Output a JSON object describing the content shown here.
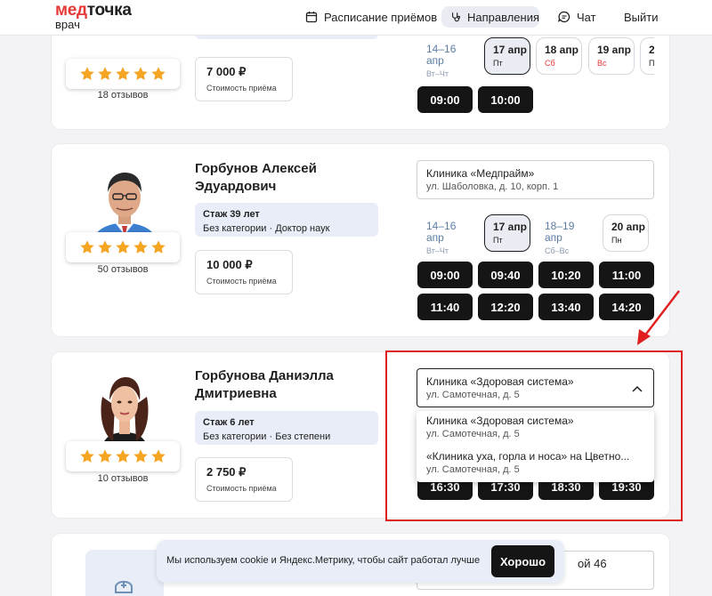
{
  "header": {
    "logo_top": "мед",
    "logo_top_2": "точка",
    "logo_sub": "врач",
    "nav": {
      "schedule": "Расписание приёмов",
      "directions": "Направления",
      "chat": "Чат",
      "logout": "Выйти"
    }
  },
  "cards": [
    {
      "reviews": "18 отзывов",
      "price": "7 000 ₽",
      "price_label": "Стоимость приёма",
      "dates": [
        {
          "d": "14–16 апр",
          "w": "Вт–Чт"
        },
        {
          "d": "17 апр",
          "w": "Пт"
        },
        {
          "d": "18 апр",
          "w": "Сб"
        },
        {
          "d": "19 апр",
          "w": "Вс"
        },
        {
          "d": "2",
          "w": "П"
        }
      ],
      "slots": [
        "09:00",
        "10:00"
      ]
    },
    {
      "name_line1": "Горбунов Алексей",
      "name_line2": "Эдуардович",
      "experience": "Стаж 39 лет",
      "category": "Без категории · Доктор наук",
      "reviews": "50 отзывов",
      "price": "10 000 ₽",
      "price_label": "Стоимость приёма",
      "clinic_name": "Клиника «Медпрайм»",
      "clinic_address": "ул. Шаболовка, д. 10, корп. 1",
      "dates": [
        {
          "d": "14–16 апр",
          "w": "Вт–Чт"
        },
        {
          "d": "17 апр",
          "w": "Пт"
        },
        {
          "d": "18–19 апр",
          "w": "Сб–Вс"
        },
        {
          "d": "20 апр",
          "w": "Пн"
        }
      ],
      "slots": [
        "09:00",
        "09:40",
        "10:20",
        "11:00",
        "11:40",
        "12:20",
        "13:40",
        "14:20"
      ]
    },
    {
      "name_line1": "Горбунова Даниэлла",
      "name_line2": "Дмитриевна",
      "experience": "Стаж 6 лет",
      "category": "Без категории · Без степени",
      "reviews": "10 отзывов",
      "price": "2 750 ₽",
      "price_label": "Стоимость приёма",
      "clinic_name": "Клиника «Здоровая система»",
      "clinic_address": "ул. Самотечная, д. 5",
      "dropdown_options": [
        {
          "name": "Клиника «Здоровая система»",
          "address": "ул. Самотечная, д. 5"
        },
        {
          "name": "«Клиника уха, горла и носа» на Цветно...",
          "address": "ул. Самотечная, д. 5"
        }
      ],
      "slots": [
        "16:30",
        "17:30",
        "18:30",
        "19:30"
      ]
    },
    {
      "clinic_partial": "ой 46"
    }
  ],
  "cookie": {
    "text": "Мы используем cookie и Яндекс.Метрику, чтобы сайт работал лучше",
    "button": "Хорошо"
  },
  "colors": {
    "brand_red": "#e53935",
    "dark": "#151515",
    "highlight": "#e9edf7",
    "annotation": "#e02020"
  }
}
